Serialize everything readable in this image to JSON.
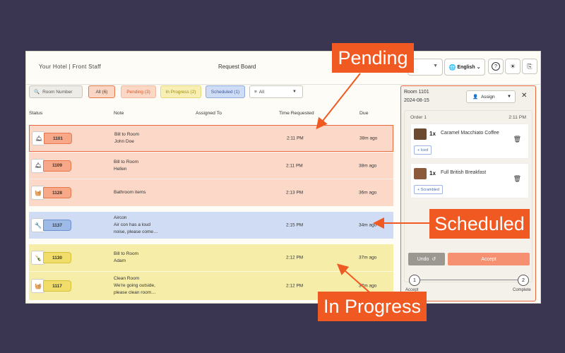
{
  "header": {
    "hotel": "Your Hotel | Front Staff",
    "board": "Request Board",
    "language": "English",
    "help_icon": "?",
    "theme_icon": "☀",
    "logout_icon": "⎘"
  },
  "filters": {
    "search_placeholder": "Room Number",
    "all": "All (6)",
    "pending": "Pending (3)",
    "in_progress": "In Progress (2)",
    "scheduled": "Scheduled (1)",
    "select_value": "All"
  },
  "columns": {
    "status": "Status",
    "note": "Note",
    "assigned": "Assigned To",
    "time": "Time Requested",
    "due": "Due"
  },
  "rows": [
    {
      "room": "1101",
      "line1": "Bill to Room",
      "line2": "John Doe",
      "line3": "",
      "time": "2:11 PM",
      "due": "38m ago",
      "status": "pending",
      "icon": "bell-icon"
    },
    {
      "room": "1109",
      "line1": "Bill to Room",
      "line2": "Hellen",
      "line3": "",
      "time": "2:11 PM",
      "due": "38m ago",
      "status": "pending",
      "icon": "bell-icon"
    },
    {
      "room": "1128",
      "line1": "Bathroom items",
      "line2": "",
      "line3": "",
      "time": "2:13 PM",
      "due": "36m ago",
      "status": "pending",
      "icon": "housekeeping-icon"
    },
    {
      "room": "1137",
      "line1": "Aircon",
      "line2": "Air con has a loud",
      "line3": "noise, please come…",
      "time": "2:15 PM",
      "due": "34m ago",
      "status": "scheduled",
      "icon": "wrench-icon"
    },
    {
      "room": "1130",
      "line1": "Bill to Room",
      "line2": "Adam",
      "line3": "",
      "time": "2:12 PM",
      "due": "37m ago",
      "status": "in_progress",
      "icon": "bottle-icon"
    },
    {
      "room": "1117",
      "line1": "Clean Room",
      "line2": "We're going outside,",
      "line3": "please clean room…",
      "time": "2:12 PM",
      "due": "37m ago",
      "status": "in_progress",
      "icon": "housekeeping-icon"
    }
  ],
  "panel": {
    "room": "Room 1101",
    "date": "2024-08-15",
    "assign": "Assign",
    "order_label": "Order 1",
    "order_time": "2:11 PM",
    "items": [
      {
        "qty": "1x",
        "name": "Caramel Macchiato Coffee",
        "tag": "+ Iced"
      },
      {
        "qty": "1x",
        "name": "Full British Breakfast",
        "tag": "+ Scrambled"
      }
    ],
    "undo": "Undo",
    "accept": "Accept",
    "step1": "1",
    "step2": "2",
    "step1_label": "Accept",
    "step2_label": "Complete"
  },
  "callouts": {
    "pending": "Pending",
    "scheduled": "Scheduled",
    "in_progress": "In Progress"
  },
  "colors": {
    "background": "#3a3550",
    "pending": "#fbd8c8",
    "scheduled": "#cfdcf3",
    "in_progress": "#f6eda8",
    "callout": "#f05a22"
  }
}
